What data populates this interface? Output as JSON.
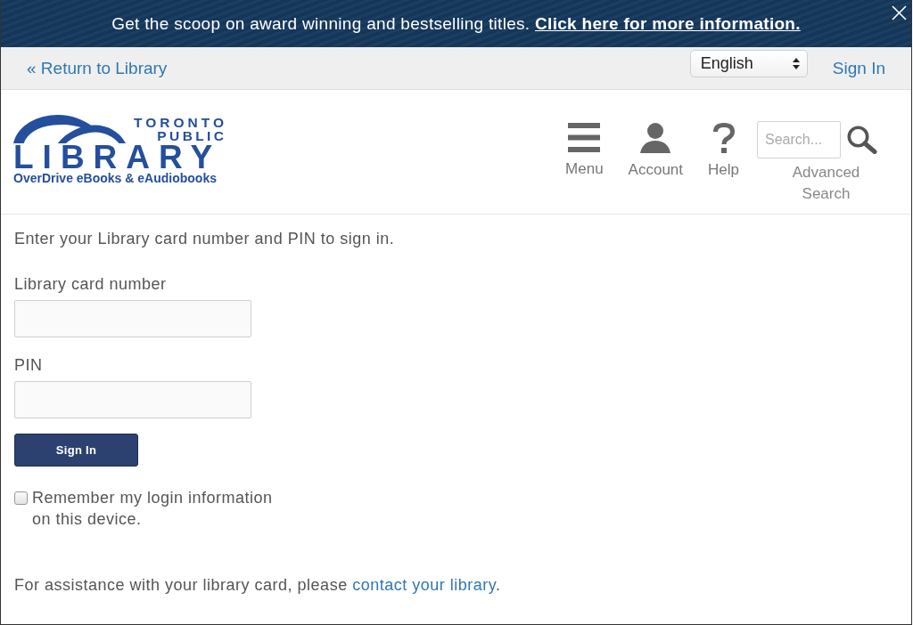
{
  "banner": {
    "text": "Get the scoop on award winning and bestselling titles.",
    "link": "Click here for more information."
  },
  "top_bar": {
    "return_link": "« Return to Library",
    "language_select": {
      "value": "English"
    },
    "sign_in_link": "Sign In"
  },
  "header": {
    "logo": {
      "line_1": "TORONTO",
      "line_2": "PUBLIC",
      "wordmark": "LIBRARY",
      "subtitle": "OverDrive eBooks & eAudiobooks"
    },
    "nav": [
      {
        "kind": "menu",
        "label": "Menu"
      },
      {
        "kind": "account",
        "label": "Account"
      },
      {
        "kind": "help",
        "label": "Help"
      }
    ],
    "search": {
      "placeholder": "Search...",
      "advanced_link": "Advanced Search"
    }
  },
  "sign_in_form": {
    "instructions": "Enter your Library card number and PIN to sign in.",
    "fields": [
      {
        "label": "Library card number"
      },
      {
        "label": "PIN"
      }
    ],
    "submit_button": "Sign In",
    "remember": {
      "label": "Remember my login information on this device.",
      "checked": false
    },
    "help": {
      "text": "For assistance with your library card, please",
      "link": "contact your library",
      "after": "."
    }
  }
}
